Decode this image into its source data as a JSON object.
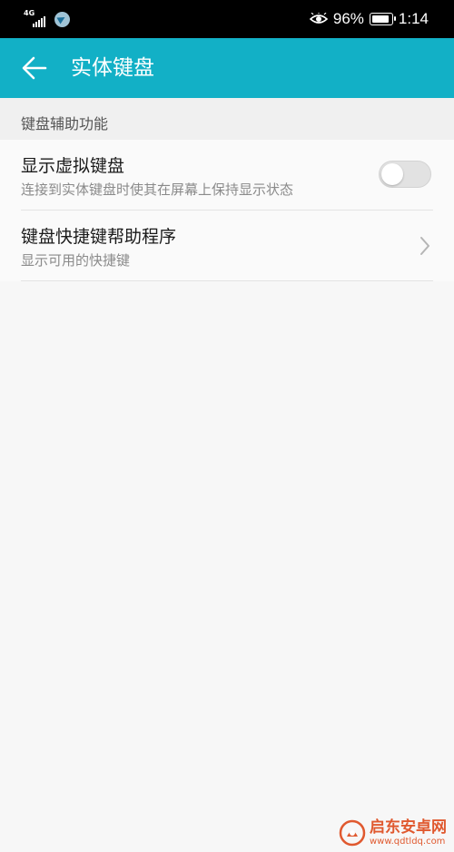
{
  "status_bar": {
    "network_label": "4G",
    "battery_percent": "96%",
    "battery_level": 0.96,
    "time": "1:14",
    "icons": [
      "signal-icon",
      "app-notification-icon",
      "eye-comfort-icon",
      "battery-icon"
    ]
  },
  "app_bar": {
    "title": "实体键盘",
    "back_icon": "arrow-left-icon",
    "background_color": "#12b0c6"
  },
  "section": {
    "header": "键盘辅助功能"
  },
  "settings": [
    {
      "title": "显示虚拟键盘",
      "subtitle": "连接到实体键盘时使其在屏幕上保持显示状态",
      "control": "toggle",
      "enabled": false
    },
    {
      "title": "键盘快捷键帮助程序",
      "subtitle": "显示可用的快捷键",
      "control": "chevron-right-icon"
    }
  ],
  "watermark": {
    "title": "启东安卓网",
    "url": "www.qdtldq.com",
    "color": "#e0592f"
  }
}
